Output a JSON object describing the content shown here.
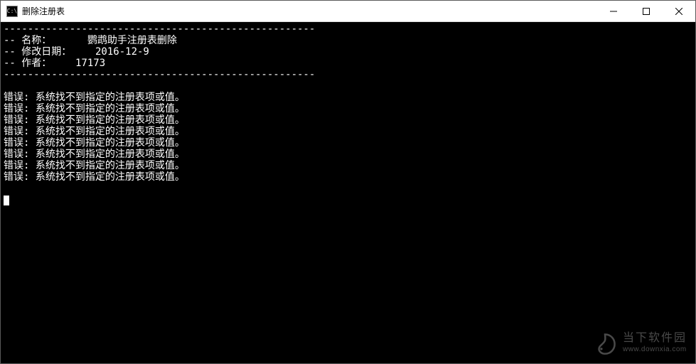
{
  "titlebar": {
    "icon_label": "C:\\",
    "title": "删除注册表"
  },
  "terminal": {
    "separator": "----------------------------------------------------",
    "header_name": "-- 名称：      鹦鹉助手注册表删除",
    "header_date": "-- 修改日期：    2016-12-9",
    "header_author": "-- 作者：    17173",
    "error_prefix": "错误:",
    "error_msg": " 系统找不到指定的注册表项或值。",
    "error_count": 8
  },
  "watermark": {
    "brand": "当下软件园",
    "url": "www.downxia.com"
  }
}
